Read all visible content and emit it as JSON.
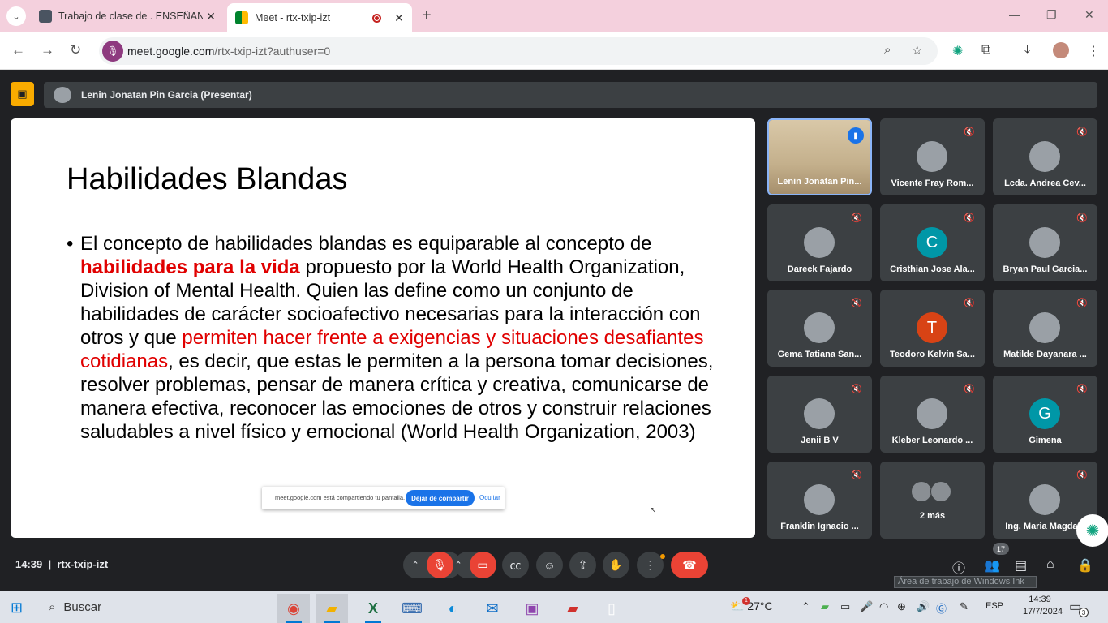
{
  "browser": {
    "tabs": [
      {
        "title": "Trabajo de clase de . ENSEÑAN",
        "active": false
      },
      {
        "title": "Meet - rtx-txip-izt",
        "active": true
      }
    ],
    "url_host": "meet.google.com",
    "url_path": "/rtx-txip-izt?authuser=0"
  },
  "meet": {
    "presenter_label": "Lenin Jonatan Pin Garcia (Presentar)",
    "meeting_code": "rtx-txip-izt",
    "time": "14:39",
    "separator": "|",
    "participants_count": "17",
    "tooltip": "Área de trabajo de Windows Ink",
    "share_bar": {
      "text": "meet.google.com está compartiendo tu pantalla.",
      "stop_button": "Dejar de compartir",
      "hide_link": "Ocultar"
    },
    "tiles": [
      {
        "name": "Lenin Jonatan Pin...",
        "type": "video",
        "speaking": true
      },
      {
        "name": "Vicente Fray Rom...",
        "type": "photo"
      },
      {
        "name": "Lcda. Andrea Cev...",
        "type": "photo"
      },
      {
        "name": "Dareck Fajardo",
        "type": "photo"
      },
      {
        "name": "Cristhian Jose Ala...",
        "type": "letter",
        "letter": "C",
        "color": "#0097a7"
      },
      {
        "name": "Bryan Paul Garcia...",
        "type": "photo"
      },
      {
        "name": "Gema Tatiana San...",
        "type": "photo"
      },
      {
        "name": "Teodoro Kelvin Sa...",
        "type": "letter",
        "letter": "T",
        "color": "#d84315"
      },
      {
        "name": "Matilde Dayanara ...",
        "type": "photo"
      },
      {
        "name": "Jenii B V",
        "type": "photo"
      },
      {
        "name": "Kleber Leonardo ...",
        "type": "photo"
      },
      {
        "name": "Gimena",
        "type": "letter",
        "letter": "G",
        "color": "#0097a7"
      },
      {
        "name": "Franklin Ignacio ...",
        "type": "photo"
      },
      {
        "name": "2 más",
        "type": "more"
      },
      {
        "name": "Ing. Maria Magda...",
        "type": "photo"
      }
    ]
  },
  "slide": {
    "title": "Habilidades Blandas",
    "bullet": "•",
    "p1": "El concepto de habilidades blandas es equiparable al concepto de ",
    "p2_bold_red": "habilidades para la vida",
    "p3": " propuesto por la World Health Organization, Division of Mental Health. Quien las define como un conjunto de habilidades de carácter socioafectivo necesarias para la interacción con otros y que ",
    "p4_red": "permiten hacer frente a exigencias y situaciones desafiantes cotidianas",
    "p5": ", es decir, que estas le permiten a la persona tomar decisiones, resolver problemas, pensar de manera crítica y creativa, comunicarse de manera efectiva, reconocer las emociones de otros y construir relaciones saludables a nivel físico y emocional (World Health Organization, 2003)"
  },
  "taskbar": {
    "search_placeholder": "Buscar",
    "temperature": "27°C",
    "language": "ESP",
    "clock_time": "14:39",
    "clock_date": "17/7/2024",
    "notifications": "3",
    "weather_badge": "1"
  },
  "colors": {
    "accent": "#1a73e8",
    "end_call": "#ea4335",
    "presenting": "#f9ab00",
    "slide_highlight": "#e00000"
  }
}
